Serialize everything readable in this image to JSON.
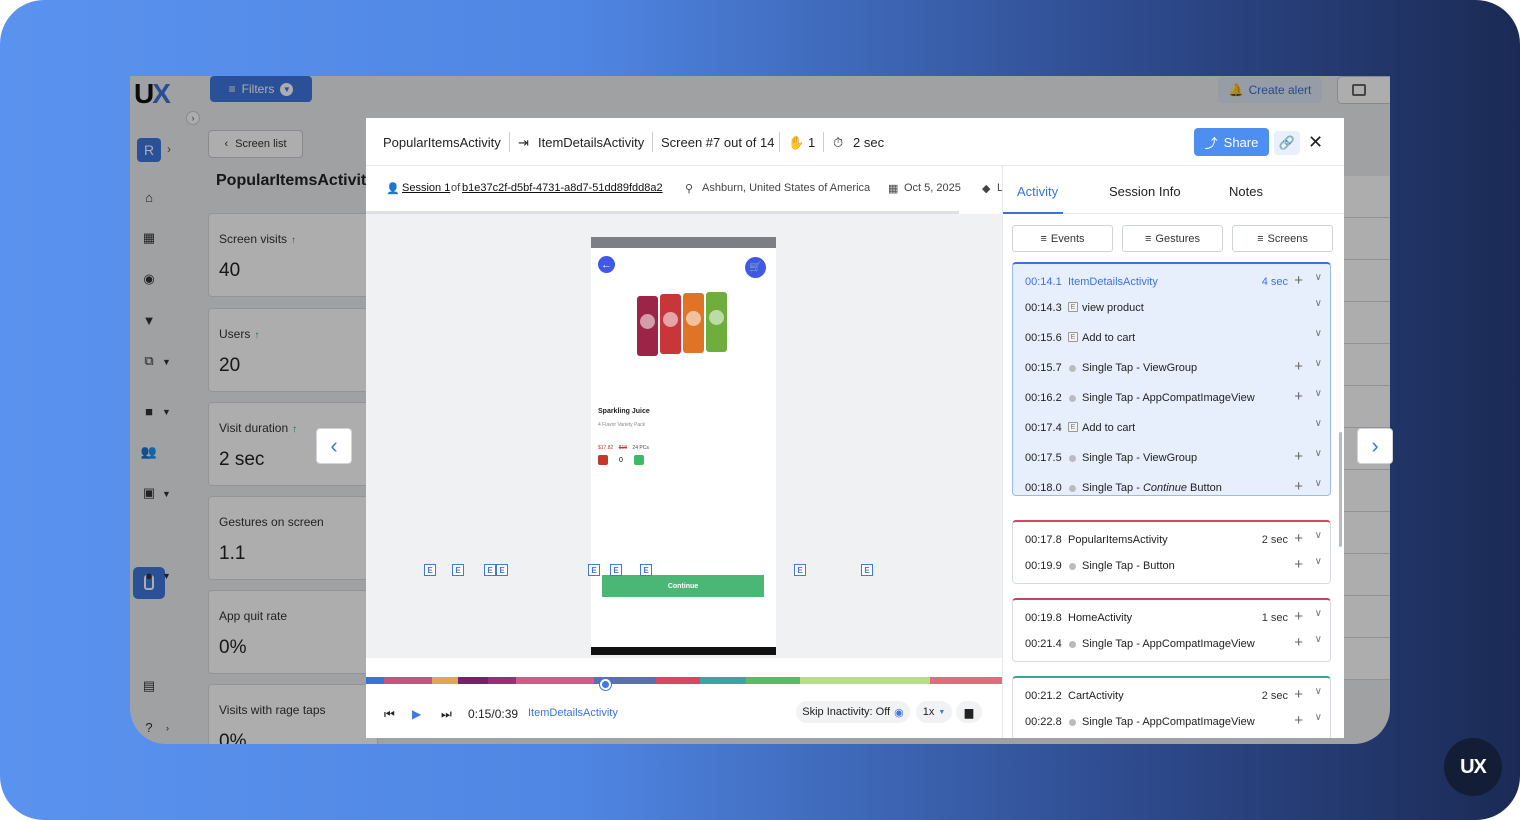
{
  "brand": {
    "logo_text": "UX",
    "corner_logo": "UX"
  },
  "toolbar": {
    "filters_label": "Filters",
    "create_alert_label": "Create alert"
  },
  "sidebar": {
    "project_initial": "R"
  },
  "page": {
    "back_label": "Screen list",
    "title": "PopularItemsActivity",
    "stats": [
      {
        "label": "Screen visits",
        "value": "40"
      },
      {
        "label": "Users",
        "value": "20"
      },
      {
        "label": "Visit duration",
        "value": "2 sec"
      },
      {
        "label": "Gestures on screen",
        "value": "1.1"
      },
      {
        "label": "App quit rate",
        "value": "0%"
      },
      {
        "label": "Visits with rage taps",
        "value": "0%"
      }
    ]
  },
  "modal": {
    "header": {
      "from_screen": "PopularItemsActivity",
      "to_screen": "ItemDetailsActivity",
      "screen_position": "Screen #7 out of 14",
      "gestures_count": "1",
      "duration": "2 sec",
      "share_label": "Share"
    },
    "info": {
      "session_label": "Session 1",
      "of_label": "of",
      "session_id": "b1e37c2f-d5bf-4731-a8d7-51dd89fdd8a2",
      "location": "Ashburn, United States of America",
      "date": "Oct 5, 2025",
      "tag_partial": "L"
    },
    "phone": {
      "product_name": "Sparkling Juice",
      "product_sub": "4 Flavor Variety Pack",
      "price_new": "$17.82",
      "price_old": "$18",
      "price_unit": "24 PCs",
      "quantity": "0",
      "continue_label": "Continue",
      "cart_badge": "1"
    },
    "timeline": {
      "event_marker": "E",
      "progress": 0.375
    },
    "controls": {
      "time": "0:15/0:39",
      "current_screen": "ItemDetailsActivity",
      "skip_label": "Skip Inactivity: Off",
      "speed": "1x"
    },
    "panel": {
      "tabs": [
        "Activity",
        "Session Info",
        "Notes"
      ],
      "filters": [
        "Events",
        "Gestures",
        "Screens"
      ],
      "groups": [
        {
          "time": "00:14.1",
          "screen": "ItemDetailsActivity",
          "duration": "4 sec",
          "accent": "#3b74d9",
          "events": [
            {
              "time": "00:14.3",
              "label": "view product"
            },
            {
              "time": "00:15.6",
              "label": "Add to cart"
            },
            {
              "time": "00:15.7",
              "label": "Single Tap - ViewGroup"
            },
            {
              "time": "00:16.2",
              "label": "Single Tap - AppCompatImageView"
            },
            {
              "time": "00:17.4",
              "label": "Add to cart"
            },
            {
              "time": "00:17.5",
              "label": "Single Tap - ViewGroup"
            },
            {
              "time": "00:18.0",
              "label_prefix": "Single Tap - ",
              "label_italic": "Continue",
              "label_suffix": " Button"
            }
          ]
        },
        {
          "time": "00:17.8",
          "screen": "PopularItemsActivity",
          "duration": "2 sec",
          "accent": "#d9465f",
          "events": [
            {
              "time": "00:19.9",
              "label": "Single Tap - Button"
            }
          ]
        },
        {
          "time": "00:19.8",
          "screen": "HomeActivity",
          "duration": "1 sec",
          "accent": "#c2475e",
          "events": [
            {
              "time": "00:21.4",
              "label": "Single Tap - AppCompatImageView"
            }
          ]
        },
        {
          "time": "00:21.2",
          "screen": "CartActivity",
          "duration": "2 sec",
          "accent": "#36a59a",
          "events": [
            {
              "time": "00:22.8",
              "label": "Single Tap - AppCompatImageView"
            }
          ]
        }
      ]
    }
  }
}
